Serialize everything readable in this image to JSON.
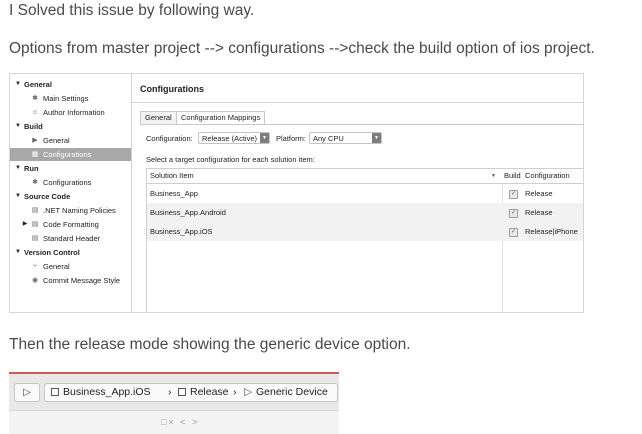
{
  "paragraphs": {
    "p1": "I Solved this issue by following way.",
    "p2": "Options from master project --> configurations -->check the build option of ios project.",
    "p3": "Then the release mode showing the generic device option."
  },
  "dialog": {
    "sidebar": [
      {
        "label": "General",
        "kind": "section",
        "icon": "disclosure-triangle"
      },
      {
        "label": "Main Settings",
        "kind": "item",
        "icon": "gear-icon"
      },
      {
        "label": "Author Information",
        "kind": "item",
        "icon": "person-icon"
      },
      {
        "label": "Build",
        "kind": "section",
        "icon": "disclosure-triangle"
      },
      {
        "label": "General",
        "kind": "item",
        "icon": "play-icon"
      },
      {
        "label": "Configurations",
        "kind": "item",
        "icon": "grid-icon",
        "selected": true
      },
      {
        "label": "Run",
        "kind": "section",
        "icon": "disclosure-triangle"
      },
      {
        "label": "Configurations",
        "kind": "item",
        "icon": "gear-icon"
      },
      {
        "label": "Source Code",
        "kind": "section",
        "icon": "disclosure-triangle"
      },
      {
        "label": ".NET Naming Policies",
        "kind": "item",
        "icon": "list-icon"
      },
      {
        "label": "Code Formatting",
        "kind": "item",
        "icon": "list-icon"
      },
      {
        "label": "Standard Header",
        "kind": "item",
        "icon": "doc-icon"
      },
      {
        "label": "Version Control",
        "kind": "section",
        "icon": "disclosure-triangle"
      },
      {
        "label": "General",
        "kind": "item",
        "icon": "branch-icon"
      },
      {
        "label": "Commit Message Style",
        "kind": "item",
        "icon": "check-icon"
      }
    ],
    "title": "Configurations",
    "tabs": [
      "General",
      "Configuration Mappings"
    ],
    "active_tab": "Configuration Mappings",
    "configuration_label": "Configuration:",
    "configuration_value": "Release (Active)",
    "platform_label": "Platform:",
    "platform_value": "Any CPU",
    "instruction": "Select a target configuration for each solution item:",
    "table": {
      "headers": [
        "Solution Item",
        "Build",
        "Configuration"
      ],
      "rows": [
        {
          "item": "Business_App",
          "build": true,
          "configuration": "Release"
        },
        {
          "item": "Business_App.Android",
          "build": true,
          "configuration": "Release"
        },
        {
          "item": "Business_App.iOS",
          "build": true,
          "configuration": "Release|iPhone"
        }
      ]
    }
  },
  "toolbar": {
    "run_icon": "run-icon",
    "path": [
      {
        "label": "Business_App.iOS",
        "icon": "project-icon"
      },
      {
        "label": "Release",
        "icon": "config-icon"
      },
      {
        "label": "Generic Device",
        "icon": "device-icon"
      }
    ],
    "separator": "›"
  },
  "colors": {
    "selected_row": "#a8a8a8",
    "accent_red": "#d0595a"
  }
}
